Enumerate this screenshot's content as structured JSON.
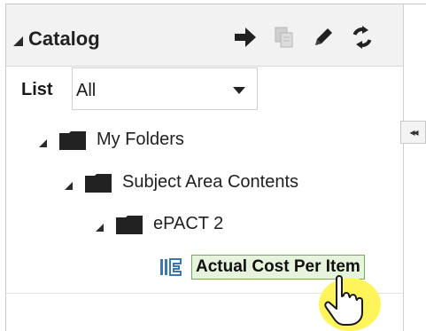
{
  "catalog": {
    "title": "Catalog"
  },
  "toolbar": {
    "items": [
      {
        "name": "arrow-right-icon",
        "enabled": true
      },
      {
        "name": "copy-icon",
        "enabled": false
      },
      {
        "name": "pencil-icon",
        "enabled": true
      },
      {
        "name": "refresh-icon",
        "enabled": true
      }
    ]
  },
  "list": {
    "label": "List",
    "value": "All"
  },
  "splitter": {
    "handle_text": "◂◂"
  },
  "tree": {
    "nodes": [
      {
        "label": "My Folders",
        "level": 0
      },
      {
        "label": "Subject Area Contents",
        "level": 1
      },
      {
        "label": "ePACT 2",
        "level": 2
      },
      {
        "label": "Actual Cost Per Item",
        "level": 3,
        "selected": true
      }
    ]
  },
  "colors": {
    "header_bg": "#f2f2f2",
    "selection_bg": "#e6f3dd",
    "selection_border": "#7aa85c",
    "analysis_icon": "#3a78b5",
    "cursor_highlight": "#fff45a"
  }
}
